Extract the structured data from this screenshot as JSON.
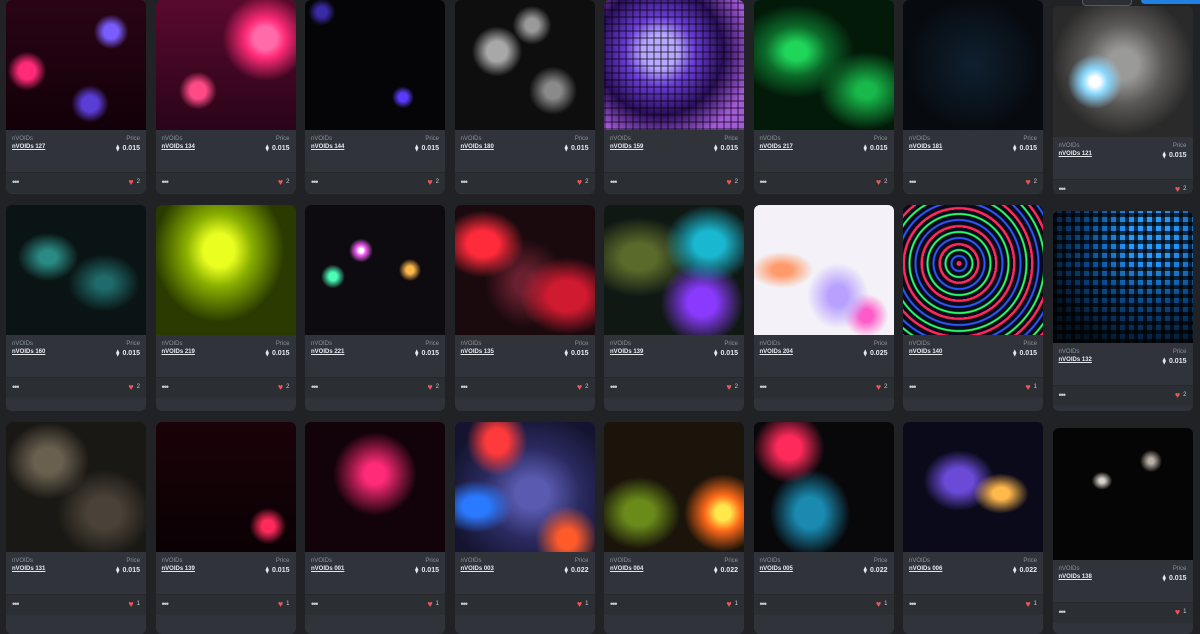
{
  "collection_label": "nVOIDs",
  "price_label": "Price",
  "cards": [
    {
      "name": "nVOIDs 127",
      "price": "0.015",
      "likes": "2"
    },
    {
      "name": "nVOIDs 134",
      "price": "0.015",
      "likes": "2"
    },
    {
      "name": "nVOIDs 144",
      "price": "0.015",
      "likes": "2"
    },
    {
      "name": "nVOIDs 180",
      "price": "0.015",
      "likes": "2"
    },
    {
      "name": "nVOIDs 159",
      "price": "0.015",
      "likes": "2"
    },
    {
      "name": "nVOIDs 217",
      "price": "0.015",
      "likes": "2"
    },
    {
      "name": "nVOIDs 181",
      "price": "0.015",
      "likes": "2"
    },
    {
      "name": "nVOIDs 121",
      "price": "0.015",
      "likes": "2"
    },
    {
      "name": "nVOIDs 160",
      "price": "0.015",
      "likes": "2"
    },
    {
      "name": "nVOIDs 219",
      "price": "0.015",
      "likes": "2"
    },
    {
      "name": "nVOIDs 221",
      "price": "0.015",
      "likes": "2"
    },
    {
      "name": "nVOIDs 135",
      "price": "0.015",
      "likes": "2"
    },
    {
      "name": "nVOIDs 139",
      "price": "0.015",
      "likes": "2"
    },
    {
      "name": "nVOIDs 204",
      "price": "0.025",
      "likes": "2"
    },
    {
      "name": "nVOIDs 140",
      "price": "0.015",
      "likes": "1"
    },
    {
      "name": "nVOIDs 132",
      "price": "0.015",
      "likes": "2"
    },
    {
      "name": "nVOIDs 131",
      "price": "0.015",
      "likes": "1"
    },
    {
      "name": "nVOIDs 139",
      "price": "0.015",
      "likes": "1"
    },
    {
      "name": "nVOIDs 001",
      "price": "0.015",
      "likes": "1"
    },
    {
      "name": "nVOIDs 003",
      "price": "0.022",
      "likes": "1"
    },
    {
      "name": "nVOIDs 004",
      "price": "0.022",
      "likes": "1"
    },
    {
      "name": "nVOIDs 005",
      "price": "0.022",
      "likes": "1"
    },
    {
      "name": "nVOIDs 006",
      "price": "0.022",
      "likes": "1"
    },
    {
      "name": "nVOIDs 138",
      "price": "0.015",
      "likes": "1"
    }
  ],
  "currency_symbol": "⧫",
  "more_symbol": "•••",
  "heart_symbol": "♥",
  "colors": {
    "background": "#202225",
    "card": "#303339",
    "heart": "#eb5757",
    "accent": "#2081e2"
  }
}
